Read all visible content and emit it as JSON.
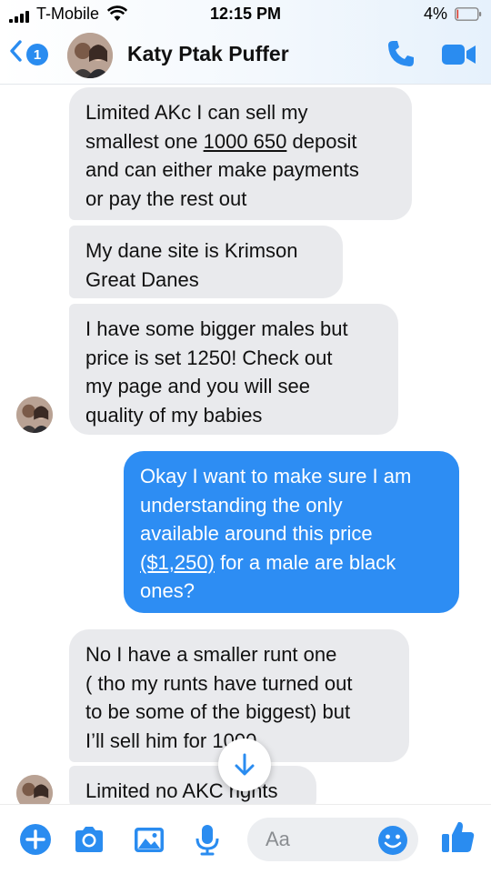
{
  "status_bar": {
    "carrier": "T-Mobile",
    "time": "12:15 PM",
    "battery": "4%"
  },
  "nav": {
    "back_badge": "1",
    "contact_name": "Katy Ptak Puffer"
  },
  "messages": [
    {
      "from": "them",
      "text": "Limited AKc I can sell my smallest one 1000 650 deposit and can either make payments or pay the rest out"
    },
    {
      "from": "them",
      "text": "My dane site is Krimson Great Danes"
    },
    {
      "from": "them",
      "text": "I have some bigger males but price is set 1250! Check out my page and you will see quality of my babies"
    },
    {
      "from": "me",
      "text": "Okay I want to make sure I am understanding the only available around this price ($1,250) for a male are black ones?"
    },
    {
      "from": "them",
      "text": "No I have a smaller runt one ( tho my runts have turned out to be some of the biggest) but I’ll sell him for 1000"
    },
    {
      "from": "them",
      "text": "Limited no AKC rights"
    }
  ],
  "composer": {
    "placeholder": "Aa"
  },
  "colors": {
    "accent": "#2d8df3",
    "incoming_bubble": "#e9eaed"
  },
  "icons": [
    "back-chevron-icon",
    "phone-icon",
    "video-icon",
    "plus-icon",
    "camera-icon",
    "gallery-icon",
    "microphone-icon",
    "emoji-icon",
    "thumbs-up-icon",
    "scroll-down-arrow-icon"
  ]
}
